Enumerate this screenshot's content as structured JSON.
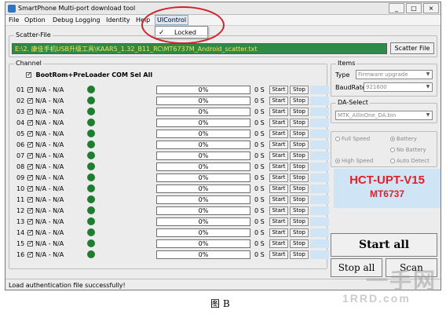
{
  "window": {
    "title": "SmartPhone Multi-port download tool",
    "minimize": "_",
    "maximize": "□",
    "close": "×"
  },
  "menu": {
    "file": "File",
    "option": "Option",
    "debug_logging": "Debug Logging",
    "identity": "Identity",
    "help": "Help",
    "uicontrol": "UIControl"
  },
  "submenu": {
    "check": "✓",
    "locked": "Locked"
  },
  "scatter": {
    "group_title": "Scatter-File",
    "path": "E:\\2. 康佳手机USB升级工具\\KAAR5_1.32_B11_RC\\MT6737M_Android_scatter.txt",
    "button": "Scatter File"
  },
  "channel": {
    "group_title": "Channel",
    "select_all": "BootRom+PreLoader COM Sel All",
    "rows": [
      {
        "idx": "01 -",
        "na": "N/A - N/A",
        "progress": "0%",
        "size": "0 S",
        "start": "Start",
        "stop": "Stop"
      },
      {
        "idx": "02 -",
        "na": "N/A - N/A",
        "progress": "0%",
        "size": "0 S",
        "start": "Start",
        "stop": "Stop"
      },
      {
        "idx": "03 -",
        "na": "N/A - N/A",
        "progress": "0%",
        "size": "0 S",
        "start": "Start",
        "stop": "Stop"
      },
      {
        "idx": "04 -",
        "na": "N/A - N/A",
        "progress": "0%",
        "size": "0 S",
        "start": "Start",
        "stop": "Stop"
      },
      {
        "idx": "05 -",
        "na": "N/A - N/A",
        "progress": "0%",
        "size": "0 S",
        "start": "Start",
        "stop": "Stop"
      },
      {
        "idx": "06 -",
        "na": "N/A - N/A",
        "progress": "0%",
        "size": "0 S",
        "start": "Start",
        "stop": "Stop"
      },
      {
        "idx": "07 -",
        "na": "N/A - N/A",
        "progress": "0%",
        "size": "0 S",
        "start": "Start",
        "stop": "Stop"
      },
      {
        "idx": "08 -",
        "na": "N/A - N/A",
        "progress": "0%",
        "size": "0 S",
        "start": "Start",
        "stop": "Stop"
      },
      {
        "idx": "09 -",
        "na": "N/A - N/A",
        "progress": "0%",
        "size": "0 S",
        "start": "Start",
        "stop": "Stop"
      },
      {
        "idx": "10 -",
        "na": "N/A - N/A",
        "progress": "0%",
        "size": "0 S",
        "start": "Start",
        "stop": "Stop"
      },
      {
        "idx": "11 -",
        "na": "N/A - N/A",
        "progress": "0%",
        "size": "0 S",
        "start": "Start",
        "stop": "Stop"
      },
      {
        "idx": "12 -",
        "na": "N/A - N/A",
        "progress": "0%",
        "size": "0 S",
        "start": "Start",
        "stop": "Stop"
      },
      {
        "idx": "13 -",
        "na": "N/A - N/A",
        "progress": "0%",
        "size": "0 S",
        "start": "Start",
        "stop": "Stop"
      },
      {
        "idx": "14 -",
        "na": "N/A - N/A",
        "progress": "0%",
        "size": "0 S",
        "start": "Start",
        "stop": "Stop"
      },
      {
        "idx": "15 -",
        "na": "N/A - N/A",
        "progress": "0%",
        "size": "0 S",
        "start": "Start",
        "stop": "Stop"
      },
      {
        "idx": "16 -",
        "na": "N/A - N/A",
        "progress": "0%",
        "size": "0 S",
        "start": "Start",
        "stop": "Stop"
      }
    ]
  },
  "items": {
    "group_title": "Items",
    "type_label": "Type",
    "type_value": "Firmware upgrade",
    "baudrate_label": "BaudRate",
    "baudrate_value": "921600"
  },
  "da": {
    "group_title": "DA-Select",
    "value": "MTK_AllInOne_DA.bin"
  },
  "radios": {
    "full_speed": "Full Speed",
    "high_speed": "High Speed",
    "battery": "Battery",
    "no_battery": "No Battery",
    "auto_detect": "Auto Detect"
  },
  "brand": {
    "line1": "HCT-UPT-V15",
    "line2": "MT6737"
  },
  "actions": {
    "start_all": "Start all",
    "stop_all": "Stop all",
    "scan": "Scan"
  },
  "status": {
    "text": "Load authentication file successfully!"
  },
  "caption": "图 B",
  "watermark": {
    "line1": "一手网",
    "line2": "1RRD.com"
  },
  "colors": {
    "scatter_bg": "#2d8b47",
    "scatter_text": "#f7e45a",
    "led": "#1e7d2e",
    "brand_red": "#e0202a",
    "highlight": "#d0202a"
  }
}
